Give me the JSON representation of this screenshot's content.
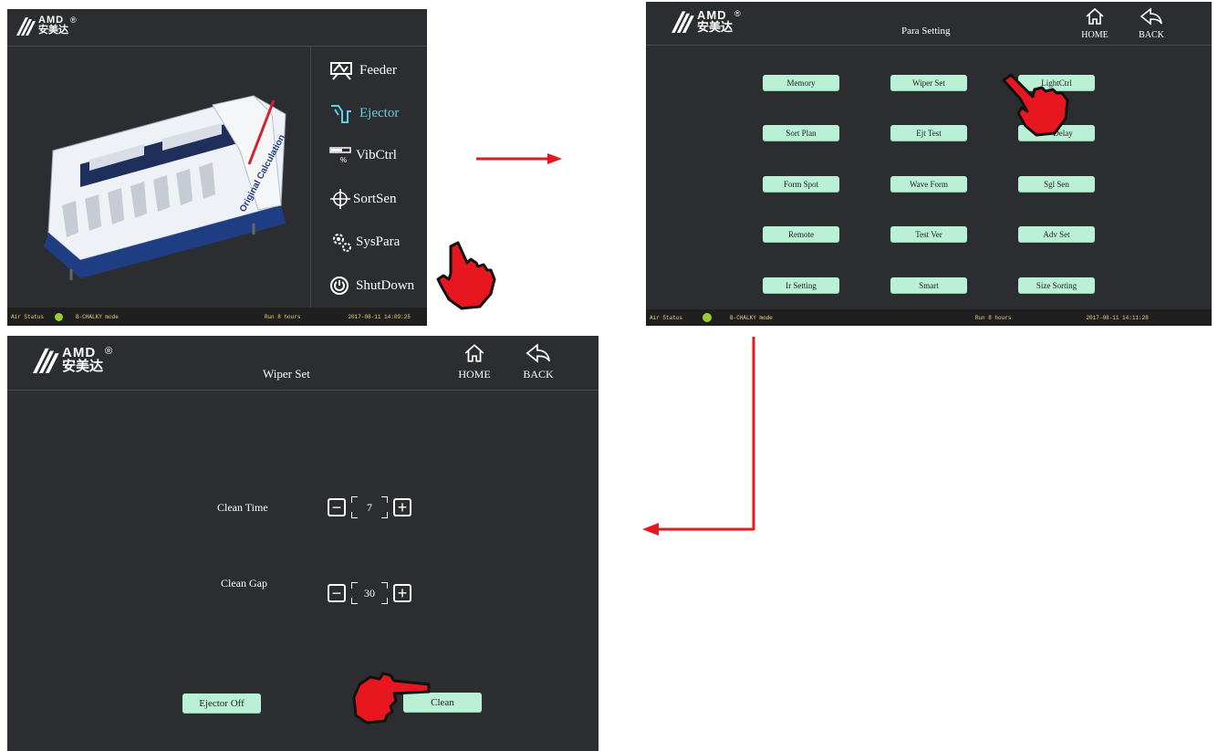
{
  "brand": {
    "en": "AMD",
    "cn": "安美达",
    "reg": "®"
  },
  "main_screen": {
    "menu": [
      {
        "label": "Feeder",
        "icon": "feeder-icon"
      },
      {
        "label": "Ejector",
        "icon": "ejector-icon"
      },
      {
        "label": "VibCtrl",
        "icon": "vibctrl-icon"
      },
      {
        "label": "SortSen",
        "icon": "crosshair-icon"
      },
      {
        "label": "SysPara",
        "icon": "gears-icon"
      },
      {
        "label": "ShutDown",
        "icon": "power-icon"
      }
    ],
    "machine_caption": "Original Calculation",
    "status": {
      "air_label": "Air Status",
      "mode": "B-CHALKY mode",
      "run": "Run 8 hours",
      "datetime": "2017-08-11 14:09:25"
    }
  },
  "para_screen": {
    "title": "Para Setting",
    "home": "HOME",
    "back": "BACK",
    "buttons": [
      [
        "Memory",
        "Wiper Set",
        "LightCtrl"
      ],
      [
        "Sort Plan",
        "Ejt Test",
        "Delay"
      ],
      [
        "Form Spot",
        "Wave Form",
        "Sgl Sen"
      ],
      [
        "Remote",
        "Test Ver",
        "Adv Set"
      ],
      [
        "Ir Setting",
        "Smart",
        "Size Sorting"
      ]
    ],
    "status": {
      "air_label": "Air Status",
      "mode": "B-CHALKY mode",
      "run": "Run 8 hours",
      "datetime": "2017-08-11 14:11:28"
    }
  },
  "wiper_screen": {
    "title": "Wiper Set",
    "home": "HOME",
    "back": "BACK",
    "clean_time_label": "Clean Time",
    "clean_time_value": "7",
    "clean_gap_label": "Clean Gap",
    "clean_gap_value": "30",
    "minus": "−",
    "plus": "+",
    "ejector_off": "Ejector Off",
    "clean": "Clean"
  },
  "colors": {
    "panel": "#2b2d30",
    "button": "#b9f0d6",
    "arrow": "#e8171f",
    "status_text": "#e8d27a"
  }
}
